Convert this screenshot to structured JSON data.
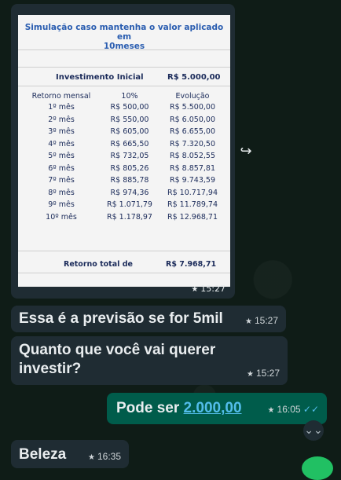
{
  "image_message": {
    "sheet": {
      "title_line1": "Simulação caso mantenha o valor aplicado em",
      "title_line2": "10meses",
      "investment_label": "Investimento Inicial",
      "investment_value": "R$ 5.000,00",
      "headers": [
        "Retorno mensal",
        "10%",
        "Evolução"
      ],
      "rows": [
        [
          "1º mês",
          "R$ 500,00",
          "R$ 5.500,00"
        ],
        [
          "2º mês",
          "R$ 550,00",
          "R$ 6.050,00"
        ],
        [
          "3º mês",
          "R$ 605,00",
          "R$ 6.655,00"
        ],
        [
          "4º mês",
          "R$ 665,50",
          "R$ 7.320,50"
        ],
        [
          "5º mês",
          "R$ 732,05",
          "R$ 8.052,55"
        ],
        [
          "6º mês",
          "R$ 805,26",
          "R$ 8.857,81"
        ],
        [
          "7º mês",
          "R$ 885,78",
          "R$ 9.743,59"
        ],
        [
          "8º mês",
          "R$ 974,36",
          "R$ 10.717,94"
        ],
        [
          "9º mês",
          "R$ 1.071,79",
          "R$ 11.789,74"
        ],
        [
          "10º mês",
          "R$ 1.178,97",
          "R$ 12.968,71"
        ]
      ],
      "total_label": "Retorno total de",
      "total_value": "R$ 7.968,71"
    },
    "time": "15:27"
  },
  "messages": [
    {
      "text": "Essa é a previsão se for 5mil",
      "time": "15:27"
    },
    {
      "text_line1": "Quanto que você vai querer",
      "text_line2": "investir?",
      "time": "15:27"
    },
    {
      "text": "Pode ser",
      "link": "2.000,00",
      "time": "16:05"
    },
    {
      "text": "Beleza",
      "time": "16:35"
    }
  ],
  "icons": {
    "star": "★",
    "forward": "↪",
    "read": "✓✓",
    "scroll_down": "⌄⌄"
  }
}
